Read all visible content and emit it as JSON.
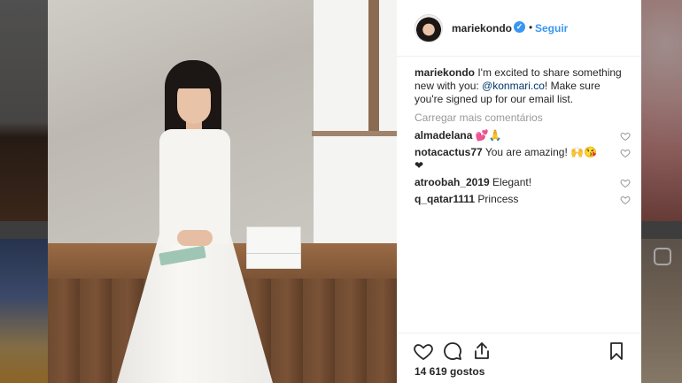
{
  "post": {
    "username": "mariekondo",
    "follow_separator": "•",
    "follow_label": "Seguir",
    "caption_user": "mariekondo",
    "caption_before": " I'm excited to share something new with you: ",
    "caption_link": "@konmari.co",
    "caption_after": "! Make sure you're signed up for our email list.",
    "load_more_label": "Carregar mais comentários",
    "likes_label": "14 619 gostos"
  },
  "comments": [
    {
      "user": "almadelana",
      "text": " 💕🙏"
    },
    {
      "user": "notacactus77",
      "text": " You are amazing! 🙌😘❤"
    },
    {
      "user": "atroobah_2019",
      "text": " Elegant!"
    },
    {
      "user": "q_qatar1111",
      "text": " Princess"
    }
  ],
  "colors": {
    "accent": "#3897f0",
    "link": "#003569",
    "muted": "#999999",
    "text": "#262626"
  },
  "icons": {
    "verified": "verified-badge-icon",
    "like": "heart-icon",
    "comment": "comment-bubble-icon",
    "share": "share-icon",
    "save": "bookmark-icon"
  }
}
